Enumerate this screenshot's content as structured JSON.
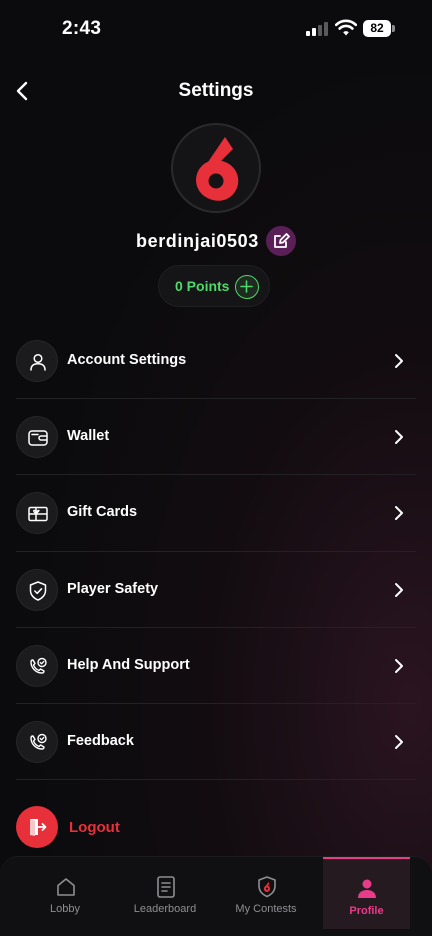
{
  "status_bar": {
    "time": "2:43",
    "battery": "82"
  },
  "header": {
    "title": "Settings"
  },
  "profile": {
    "username": "berdinjai0503",
    "points": "0 Points"
  },
  "menu": {
    "items": [
      {
        "label": "Account Settings",
        "icon": "user-icon"
      },
      {
        "label": "Wallet",
        "icon": "wallet-icon"
      },
      {
        "label": "Gift Cards",
        "icon": "gift-card-icon"
      },
      {
        "label": "Player Safety",
        "icon": "shield-check-icon"
      },
      {
        "label": "Help And Support",
        "icon": "support-phone-icon"
      },
      {
        "label": "Feedback",
        "icon": "feedback-phone-icon"
      }
    ],
    "logout_label": "Logout"
  },
  "tab_bar": {
    "tabs": [
      {
        "label": "Lobby",
        "icon": "home-icon"
      },
      {
        "label": "Leaderboard",
        "icon": "leaderboard-icon"
      },
      {
        "label": "My Contests",
        "icon": "contests-shield-icon"
      },
      {
        "label": "Profile",
        "icon": "profile-icon",
        "active": true
      }
    ]
  },
  "colors": {
    "accent": "#e83c8a",
    "danger": "#e8303a",
    "points": "#4fd86b",
    "brand": "#e8303a"
  }
}
